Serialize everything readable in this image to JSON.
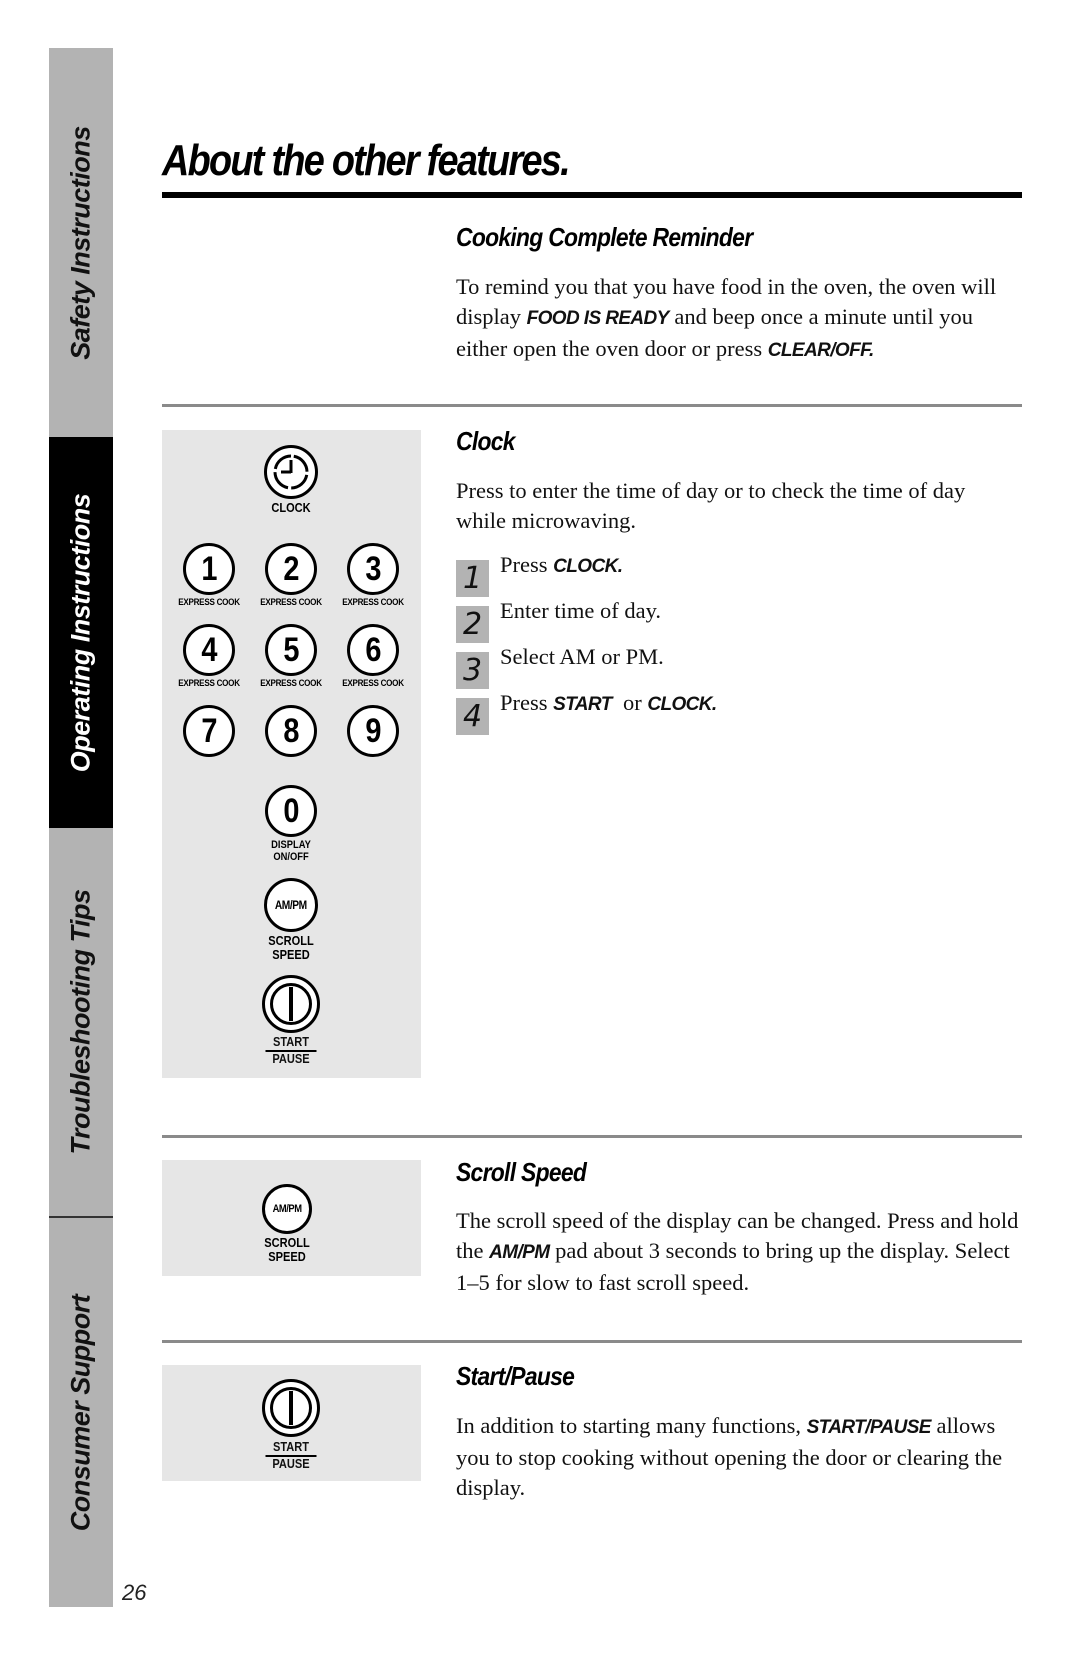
{
  "sidebar": {
    "tabs": [
      {
        "label": "Safety Instructions",
        "active": false
      },
      {
        "label": "Operating Instructions",
        "active": true
      },
      {
        "label": "Troubleshooting Tips",
        "active": false
      },
      {
        "label": "Consumer Support",
        "active": false
      }
    ],
    "page_number": "26"
  },
  "page": {
    "title": "About the other features."
  },
  "sections": {
    "cooking_complete": {
      "heading": "Cooking Complete Reminder",
      "body_parts": [
        "To remind you that you have food in the oven, the oven will display ",
        "FOOD IS READY",
        " and beep once a minute until you either open the oven door or press ",
        "CLEAR/OFF."
      ]
    },
    "clock": {
      "heading": "Clock",
      "body": "Press to enter the time of day or to check the time of day while microwaving.",
      "steps": [
        {
          "num": "1",
          "pre": "Press ",
          "kw": "CLOCK.",
          "mid": "",
          "kw2": ""
        },
        {
          "num": "2",
          "pre": "Enter time of day.",
          "kw": "",
          "mid": "",
          "kw2": ""
        },
        {
          "num": "3",
          "pre": "Select AM or PM.",
          "kw": "",
          "mid": "",
          "kw2": ""
        },
        {
          "num": "4",
          "pre": "Press ",
          "kw": "START",
          "mid": "  or ",
          "kw2": "CLOCK."
        }
      ]
    },
    "scroll_speed": {
      "heading": "Scroll Speed",
      "body_parts": [
        "The scroll speed of the display can be changed. Press and hold the ",
        "AM/PM",
        "  pad about 3 seconds to bring up the display. Select 1–5 for slow to fast scroll speed."
      ]
    },
    "start_pause": {
      "heading": "Start/Pause",
      "body_parts": [
        "In addition to starting many functions, ",
        "START/PAUSE",
        " allows you to stop cooking without opening the door or clearing the display."
      ]
    }
  },
  "keypad": {
    "clock_label": "CLOCK",
    "digits": [
      {
        "digit": "1",
        "caption": "EXPRESS COOK"
      },
      {
        "digit": "2",
        "caption": "EXPRESS COOK"
      },
      {
        "digit": "3",
        "caption": "EXPRESS COOK"
      },
      {
        "digit": "4",
        "caption": "EXPRESS COOK"
      },
      {
        "digit": "5",
        "caption": "EXPRESS COOK"
      },
      {
        "digit": "6",
        "caption": "EXPRESS COOK"
      },
      {
        "digit": "7",
        "caption": ""
      },
      {
        "digit": "8",
        "caption": ""
      },
      {
        "digit": "9",
        "caption": ""
      }
    ],
    "zero": {
      "digit": "0",
      "caption_line1": "DISPLAY",
      "caption_line2": "ON/OFF"
    },
    "ampm": {
      "label": "AM/PM",
      "caption_line1": "SCROLL",
      "caption_line2": "SPEED"
    },
    "start": {
      "caption_line1": "START",
      "caption_line2": "PAUSE"
    }
  }
}
